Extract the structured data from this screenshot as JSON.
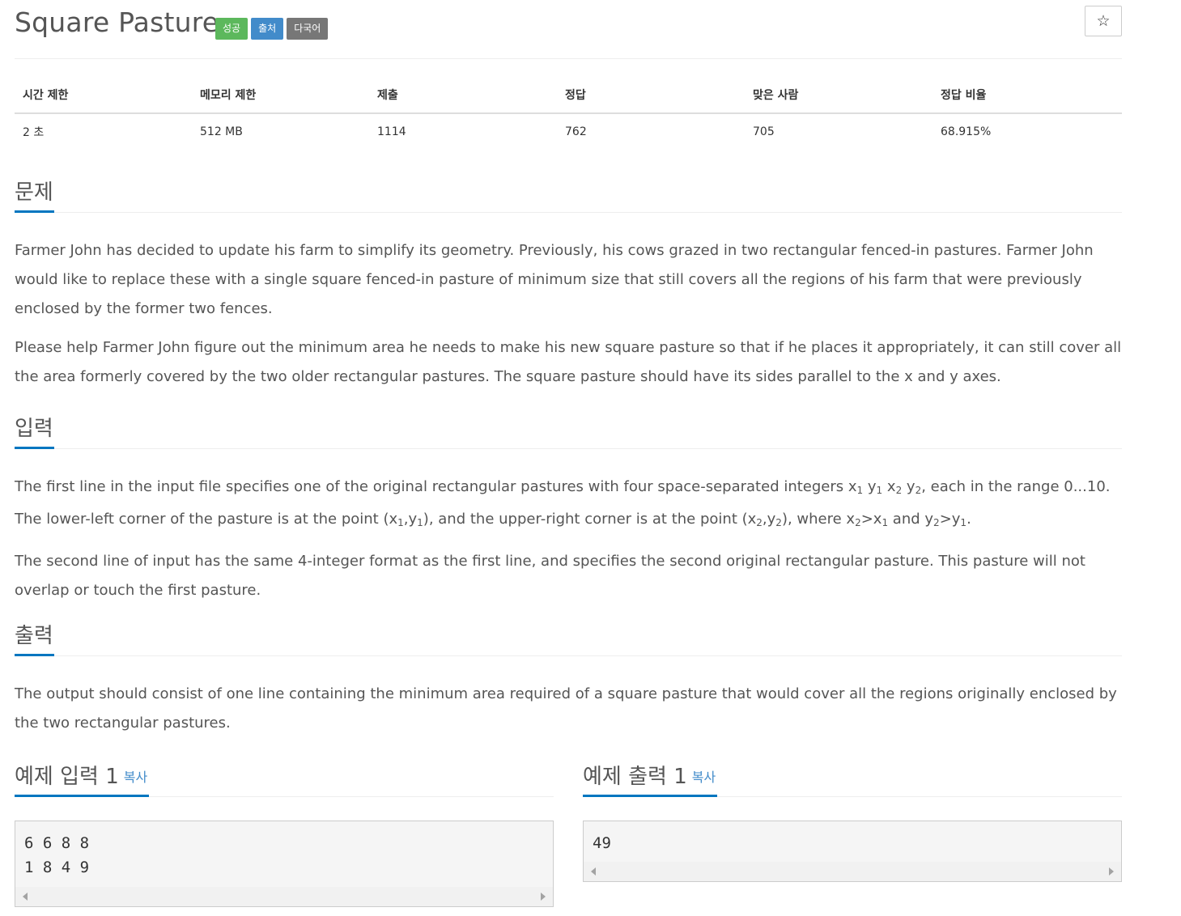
{
  "problem": {
    "title": "Square Pasture",
    "labels": [
      "성공",
      "출처",
      "다국어"
    ],
    "star_glyph": "☆"
  },
  "info_table": {
    "headers": [
      "시간 제한",
      "메모리 제한",
      "제출",
      "정답",
      "맞은 사람",
      "정답 비율"
    ],
    "values": [
      "2 초",
      "512 MB",
      "1114",
      "762",
      "705",
      "68.915%"
    ]
  },
  "sections": {
    "description": {
      "heading": "문제",
      "paragraphs": [
        "Farmer John has decided to update his farm to simplify its geometry. Previously, his cows grazed in two rectangular fenced-in pastures. Farmer John would like to replace these with a single square fenced-in pasture of minimum size that still covers all the regions of his farm that were previously enclosed by the former two fences.",
        "Please help Farmer John figure out the minimum area he needs to make his new square pasture so that if he places it appropriately, it can still cover all the area formerly covered by the two older rectangular pastures. The square pasture should have its sides parallel to the x and y axes."
      ]
    },
    "input": {
      "heading": "입력",
      "p1_a": "The first line in the input file specifies one of the original rectangular pastures with four space-separated integers x",
      "p1_b": " y",
      "p1_c": " x",
      "p1_d": " y",
      "p1_e": ", each in the range 0...10. The lower-left corner of the pasture is at the point (x",
      "p1_f": ",y",
      "p1_g": "), and the upper-right corner is at the point (x",
      "p1_h": ",y",
      "p1_i": "), where x",
      "p1_j": ">x",
      "p1_k": " and y",
      "p1_l": ">y",
      "p1_m": ".",
      "sub1": "1",
      "sub2": "2",
      "p2": "The second line of input has the same 4-integer format as the first line, and specifies the second original rectangular pasture. This pasture will not overlap or touch the first pasture."
    },
    "output": {
      "heading": "출력",
      "paragraphs": [
        "The output should consist of one line containing the minimum area required of a square pasture that would cover all the regions originally enclosed by the two rectangular pastures."
      ]
    }
  },
  "samples": {
    "input": {
      "heading": "예제 입력 1",
      "copy_label": "복사",
      "content": "6 6 8 8\n1 8 4 9"
    },
    "output": {
      "heading": "예제 출력 1",
      "copy_label": "복사",
      "content": "49"
    }
  }
}
